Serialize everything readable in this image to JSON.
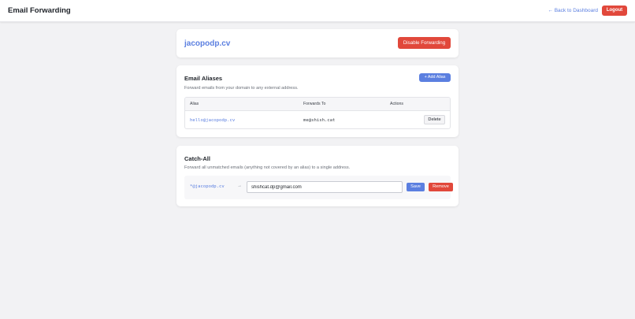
{
  "header": {
    "title": "Email Forwarding",
    "back_link": "← Back to Dashboard",
    "logout_label": "Logout"
  },
  "domain_card": {
    "domain": "jacopodp.cv",
    "disable_label": "Disable Forwarding"
  },
  "aliases": {
    "title": "Email Aliases",
    "description": "Forward emails from your domain to any external address.",
    "add_label": "+ Add Alias",
    "columns": [
      "Alias",
      "Forwards To",
      "Actions"
    ],
    "rows": [
      {
        "alias": "hello@jacopodp.cv",
        "forwards_to": "me@shish.cat",
        "action_label": "Delete"
      }
    ]
  },
  "catchall": {
    "title": "Catch-All",
    "description": "Forward all unmatched emails (anything not covered by an alias) to a single address.",
    "pattern": "*@jacopodp.cv",
    "arrow": "→",
    "input_value": "shishcat.dp@gmail.com",
    "save_label": "Save",
    "remove_label": "Remove"
  },
  "colors": {
    "accent": "#5b7fe0",
    "danger": "#e1483b",
    "background": "#f2f2f4"
  }
}
